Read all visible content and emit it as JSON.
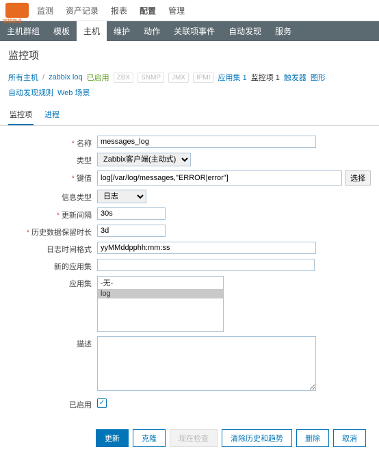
{
  "topnav": {
    "items": [
      "监测",
      "资产记录",
      "报表",
      "配置",
      "管理"
    ],
    "active": 3
  },
  "subnav": {
    "items": [
      "主机群组",
      "模板",
      "主机",
      "维护",
      "动作",
      "关联项事件",
      "自动发现",
      "服务"
    ],
    "active": 2
  },
  "page_title": "监控项",
  "breadcrumb": {
    "all_hosts": "所有主机",
    "host": "zabbix loq",
    "enabled": "已启用",
    "disabled_tags": [
      "ZBX",
      "SNMP",
      "JMX",
      "IPMI"
    ],
    "links": [
      "应用集 1",
      "监控项 1",
      "触发器",
      "图形",
      "自动发现规则",
      "Web 场景"
    ],
    "active_link": 1
  },
  "tabs": {
    "items": [
      "监控项",
      "进程"
    ],
    "active": 0
  },
  "form": {
    "name": {
      "label": "名称",
      "value": "messages_log"
    },
    "type": {
      "label": "类型",
      "value": "Zabbix客户端(主动式)"
    },
    "key": {
      "label": "键值",
      "value": "log[/var/log/messages,\"ERROR|error\"]",
      "select_btn": "选择"
    },
    "info_type": {
      "label": "信息类型",
      "value": "日志"
    },
    "interval": {
      "label": "更新间隔",
      "value": "30s"
    },
    "history": {
      "label": "历史数据保留时长",
      "value": "3d"
    },
    "log_time": {
      "label": "日志时间格式",
      "value": "yyMMddpphh:mm:ss"
    },
    "new_appset": {
      "label": "新的应用集",
      "value": ""
    },
    "appset": {
      "label": "应用集",
      "options": [
        "-无-",
        "log"
      ],
      "selected": 1
    },
    "desc": {
      "label": "描述",
      "value": ""
    },
    "enabled": {
      "label": "已启用",
      "checked": true
    }
  },
  "buttons": {
    "update": "更新",
    "clone": "克隆",
    "checknow": "现在检查",
    "clear": "清除历史和趋势",
    "delete": "删除",
    "cancel": "取消"
  }
}
